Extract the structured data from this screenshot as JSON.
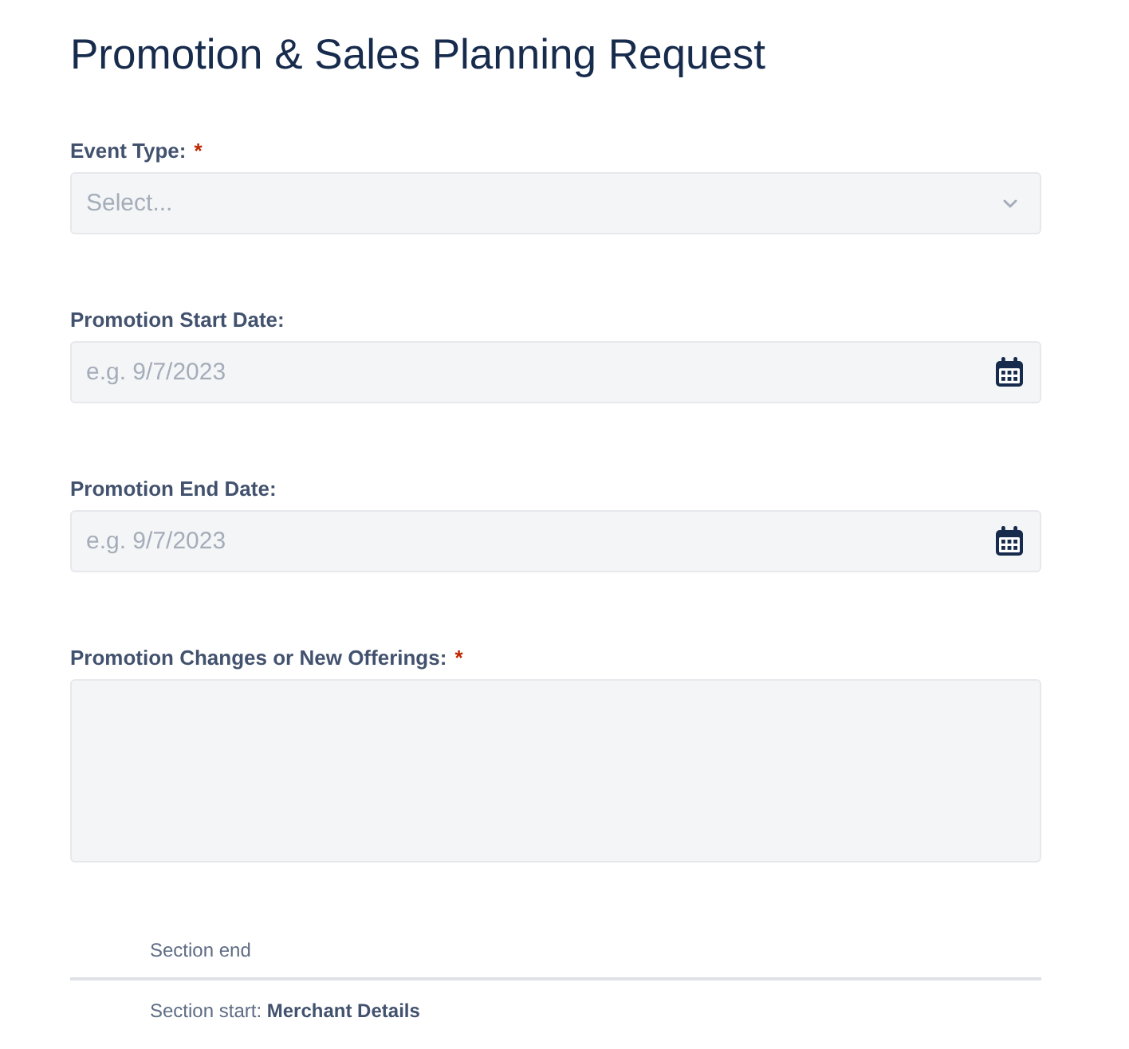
{
  "title": "Promotion & Sales Planning Request",
  "fields": [
    {
      "kind": "select",
      "label": "Event Type:",
      "required_mark": "*",
      "placeholder": "Select..."
    },
    {
      "kind": "date",
      "label": "Promotion Start Date:",
      "placeholder": "e.g. 9/7/2023"
    },
    {
      "kind": "date",
      "label": "Promotion End Date:",
      "placeholder": "e.g. 9/7/2023"
    },
    {
      "kind": "textarea",
      "label": "Promotion Changes or New Offerings:",
      "required_mark": "*"
    }
  ],
  "section_end": {
    "label": "Section end"
  },
  "section_start": {
    "label": "Section start: **Merchant Details**"
  }
}
